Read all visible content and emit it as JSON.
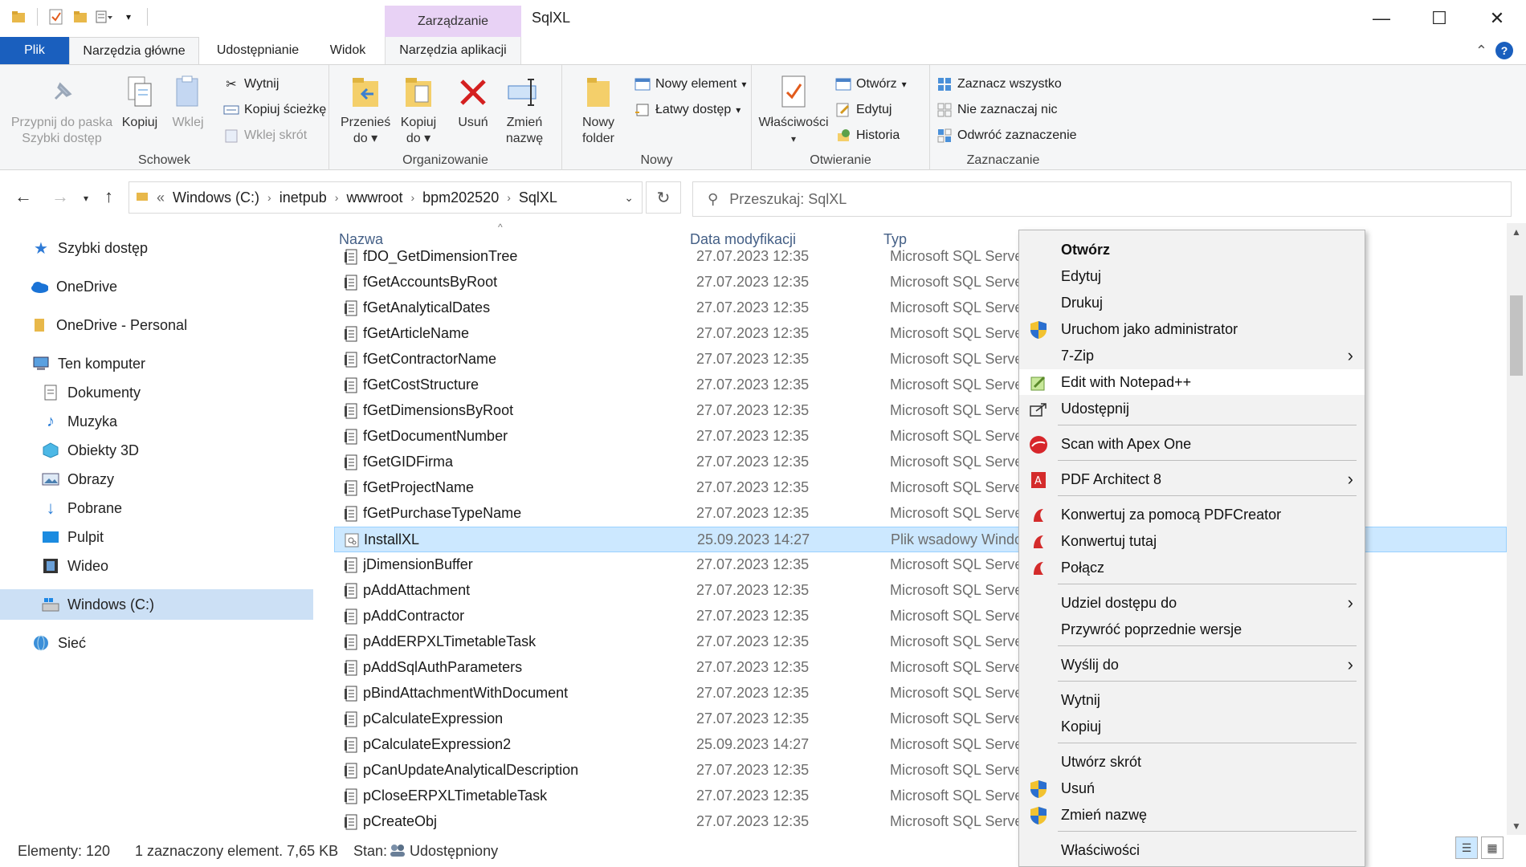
{
  "window": {
    "title": "SqlXL",
    "manage_tab": "Zarządzanie",
    "minimize": "—",
    "maximize": "☐",
    "close": "✕"
  },
  "ribbon_tabs": {
    "file": "Plik",
    "home": "Narzędzia główne",
    "share": "Udostępnianie",
    "view": "Widok",
    "app_tools": "Narzędzia aplikacji",
    "collapse": "⌃",
    "help": "?"
  },
  "ribbon": {
    "clipboard": {
      "label": "Schowek",
      "pin": "Przypnij do paska Szybki dostęp",
      "pin_l1": "Przypnij do paska",
      "pin_l2": "Szybki dostęp",
      "copy": "Kopiuj",
      "paste": "Wklej",
      "cut": "Wytnij",
      "copy_path": "Kopiuj ścieżkę",
      "paste_shortcut": "Wklej skrót"
    },
    "organize": {
      "label": "Organizowanie",
      "move_to_l1": "Przenieś",
      "move_to_l2": "do",
      "copy_to_l1": "Kopiuj",
      "copy_to_l2": "do",
      "delete": "Usuń",
      "rename_l1": "Zmień",
      "rename_l2": "nazwę"
    },
    "new": {
      "label": "Nowy",
      "new_folder_l1": "Nowy",
      "new_folder_l2": "folder",
      "new_item": "Nowy element",
      "easy_access": "Łatwy dostęp"
    },
    "open": {
      "label": "Otwieranie",
      "properties": "Właściwości",
      "open": "Otwórz",
      "edit": "Edytuj",
      "history": "Historia"
    },
    "select": {
      "label": "Zaznaczanie",
      "select_all": "Zaznacz wszystko",
      "select_none": "Nie zaznaczaj nic",
      "invert": "Odwróć zaznaczenie"
    }
  },
  "address": {
    "crumbs": [
      "«",
      "Windows (C:)",
      "inetpub",
      "wwwroot",
      "bpm202520",
      "SqlXL"
    ],
    "search_placeholder": "Przeszukaj: SqlXL"
  },
  "nav": {
    "quick_access": "Szybki dostęp",
    "onedrive": "OneDrive",
    "onedrive_personal": "OneDrive - Personal",
    "this_pc": "Ten komputer",
    "documents": "Dokumenty",
    "music": "Muzyka",
    "objects3d": "Obiekty 3D",
    "pictures": "Obrazy",
    "downloads": "Pobrane",
    "desktop": "Pulpit",
    "videos": "Wideo",
    "windows_c": "Windows (C:)",
    "network": "Sieć"
  },
  "columns": {
    "name": "Nazwa",
    "date": "Data modyfikacji",
    "type": "Typ"
  },
  "files": [
    {
      "name": "fDO_GetDimensionTree",
      "date": "27.07.2023 12:35",
      "type": "Microsoft SQL Server"
    },
    {
      "name": "fGetAccountsByRoot",
      "date": "27.07.2023 12:35",
      "type": "Microsoft SQL Server"
    },
    {
      "name": "fGetAnalyticalDates",
      "date": "27.07.2023 12:35",
      "type": "Microsoft SQL Server"
    },
    {
      "name": "fGetArticleName",
      "date": "27.07.2023 12:35",
      "type": "Microsoft SQL Server"
    },
    {
      "name": "fGetContractorName",
      "date": "27.07.2023 12:35",
      "type": "Microsoft SQL Server"
    },
    {
      "name": "fGetCostStructure",
      "date": "27.07.2023 12:35",
      "type": "Microsoft SQL Server"
    },
    {
      "name": "fGetDimensionsByRoot",
      "date": "27.07.2023 12:35",
      "type": "Microsoft SQL Server"
    },
    {
      "name": "fGetDocumentNumber",
      "date": "27.07.2023 12:35",
      "type": "Microsoft SQL Server"
    },
    {
      "name": "fGetGIDFirma",
      "date": "27.07.2023 12:35",
      "type": "Microsoft SQL Server"
    },
    {
      "name": "fGetProjectName",
      "date": "27.07.2023 12:35",
      "type": "Microsoft SQL Server"
    },
    {
      "name": "fGetPurchaseTypeName",
      "date": "27.07.2023 12:35",
      "type": "Microsoft SQL Server"
    },
    {
      "name": "InstallXL",
      "date": "25.09.2023 14:27",
      "type": "Plik wsadowy Windows"
    },
    {
      "name": "jDimensionBuffer",
      "date": "27.07.2023 12:35",
      "type": "Microsoft SQL Server"
    },
    {
      "name": "pAddAttachment",
      "date": "27.07.2023 12:35",
      "type": "Microsoft SQL Server"
    },
    {
      "name": "pAddContractor",
      "date": "27.07.2023 12:35",
      "type": "Microsoft SQL Server"
    },
    {
      "name": "pAddERPXLTimetableTask",
      "date": "27.07.2023 12:35",
      "type": "Microsoft SQL Server"
    },
    {
      "name": "pAddSqlAuthParameters",
      "date": "27.07.2023 12:35",
      "type": "Microsoft SQL Server"
    },
    {
      "name": "pBindAttachmentWithDocument",
      "date": "27.07.2023 12:35",
      "type": "Microsoft SQL Server"
    },
    {
      "name": "pCalculateExpression",
      "date": "27.07.2023 12:35",
      "type": "Microsoft SQL Server"
    },
    {
      "name": "pCalculateExpression2",
      "date": "25.09.2023 14:27",
      "type": "Microsoft SQL Server"
    },
    {
      "name": "pCanUpdateAnalyticalDescription",
      "date": "27.07.2023 12:35",
      "type": "Microsoft SQL Server"
    },
    {
      "name": "pCloseERPXLTimetableTask",
      "date": "27.07.2023 12:35",
      "type": "Microsoft SQL Server"
    },
    {
      "name": "pCreateObj",
      "date": "27.07.2023 12:35",
      "type": "Microsoft SQL Server"
    }
  ],
  "status": {
    "count": "Elementy: 120",
    "selection": "1 zaznaczony element. 7,65 KB",
    "state_label": "Stan:",
    "state_value": "Udostępniony"
  },
  "context_menu": {
    "open": "Otwórz",
    "edit": "Edytuj",
    "print": "Drukuj",
    "run_as_admin": "Uruchom jako administrator",
    "zip7": "7-Zip",
    "notepadpp": "Edit with Notepad++",
    "share": "Udostępnij",
    "apex": "Scan with Apex One",
    "pdf_architect": "PDF Architect 8",
    "pdfcreator_convert": "Konwertuj za pomocą PDFCreator",
    "convert_here": "Konwertuj tutaj",
    "merge": "Połącz",
    "give_access": "Udziel dostępu do",
    "restore_versions": "Przywróć poprzednie wersje",
    "send_to": "Wyślij do",
    "cut": "Wytnij",
    "copy": "Kopiuj",
    "create_shortcut": "Utwórz skrót",
    "delete": "Usuń",
    "rename": "Zmień nazwę",
    "properties": "Właściwości"
  },
  "colors": {
    "accent": "#1a5fbe",
    "selection": "#cce8ff",
    "manage_tab": "#e8d2f5",
    "context_menu_bg": "#f2f2f2"
  }
}
